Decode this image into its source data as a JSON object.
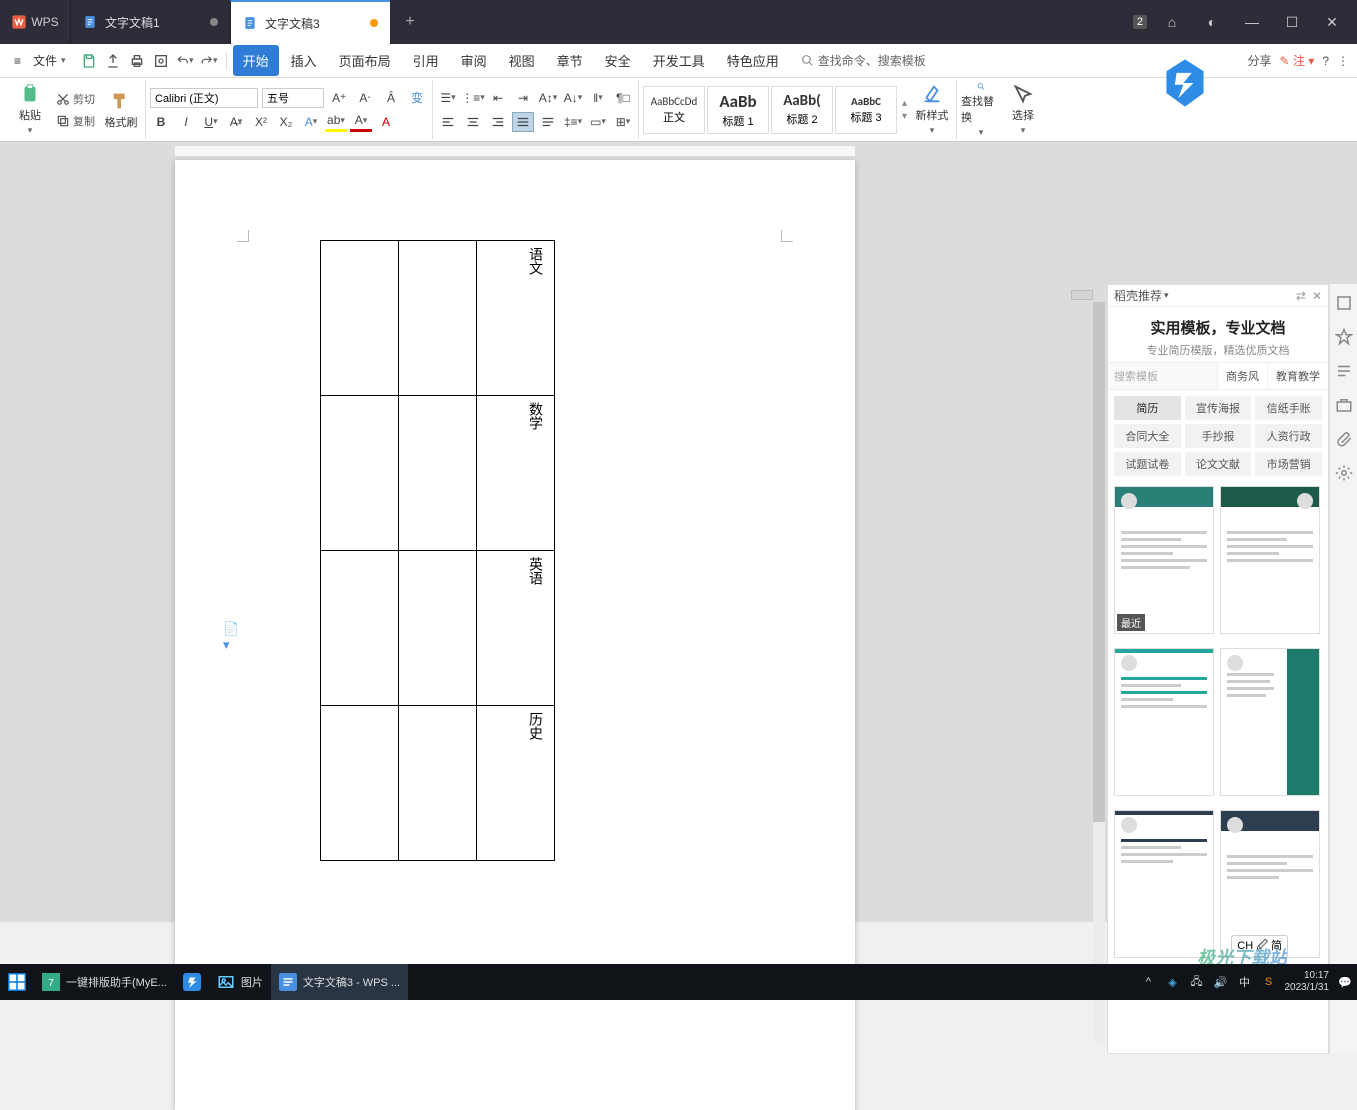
{
  "titlebar": {
    "brand": "WPS",
    "tabs": [
      {
        "label": "文字文稿1",
        "active": false
      },
      {
        "label": "文字文稿3",
        "active": true
      }
    ],
    "badge": "2"
  },
  "menubar": {
    "file": "文件",
    "tabs": [
      "开始",
      "插入",
      "页面布局",
      "引用",
      "审阅",
      "视图",
      "章节",
      "安全",
      "开发工具",
      "特色应用"
    ],
    "search_hint": "查找命令、搜索模板",
    "share": "分享",
    "note": "注"
  },
  "ribbon": {
    "clipboard": {
      "paste": "粘贴",
      "cut": "剪切",
      "copy": "复制",
      "format_painter": "格式刷"
    },
    "font": {
      "family": "Calibri (正文)",
      "size": "五号"
    },
    "styles": {
      "items": [
        {
          "preview": "AaBbCcDd",
          "label": "正文"
        },
        {
          "preview": "AaBb",
          "label": "标题 1"
        },
        {
          "preview": "AaBb(",
          "label": "标题 2"
        },
        {
          "preview": "AaBbC",
          "label": "标题 3"
        }
      ],
      "new_style": "新样式"
    },
    "editing": {
      "find_replace": "查找替换",
      "select": "选择"
    }
  },
  "document": {
    "table_cells": [
      "语文",
      "数学",
      "英语",
      "历史"
    ]
  },
  "sidepanel": {
    "head": "稻壳推荐",
    "banner_title": "实用模板，专业文档",
    "banner_sub": "专业简历模版，精选优质文档",
    "search_placeholder": "搜索模板",
    "filter_tabs": [
      "商务风",
      "教育教学"
    ],
    "tag_rows": [
      [
        "简历",
        "宣传海报",
        "信纸手账"
      ],
      [
        "合同大全",
        "手抄报",
        "人资行政"
      ],
      [
        "试题试卷",
        "论文文献",
        "市场营销"
      ]
    ],
    "recent_label": "最近",
    "lang_indicator": "CH 🖉 简"
  },
  "taskbar": {
    "items": [
      {
        "label": "一键排版助手(MyE..."
      },
      {
        "label": ""
      },
      {
        "label": "图片"
      },
      {
        "label": "文字文稿3 - WPS ..."
      }
    ],
    "ime": "中",
    "time": "10:17",
    "date": "2023/1/31"
  },
  "watermark": "极光下载站"
}
